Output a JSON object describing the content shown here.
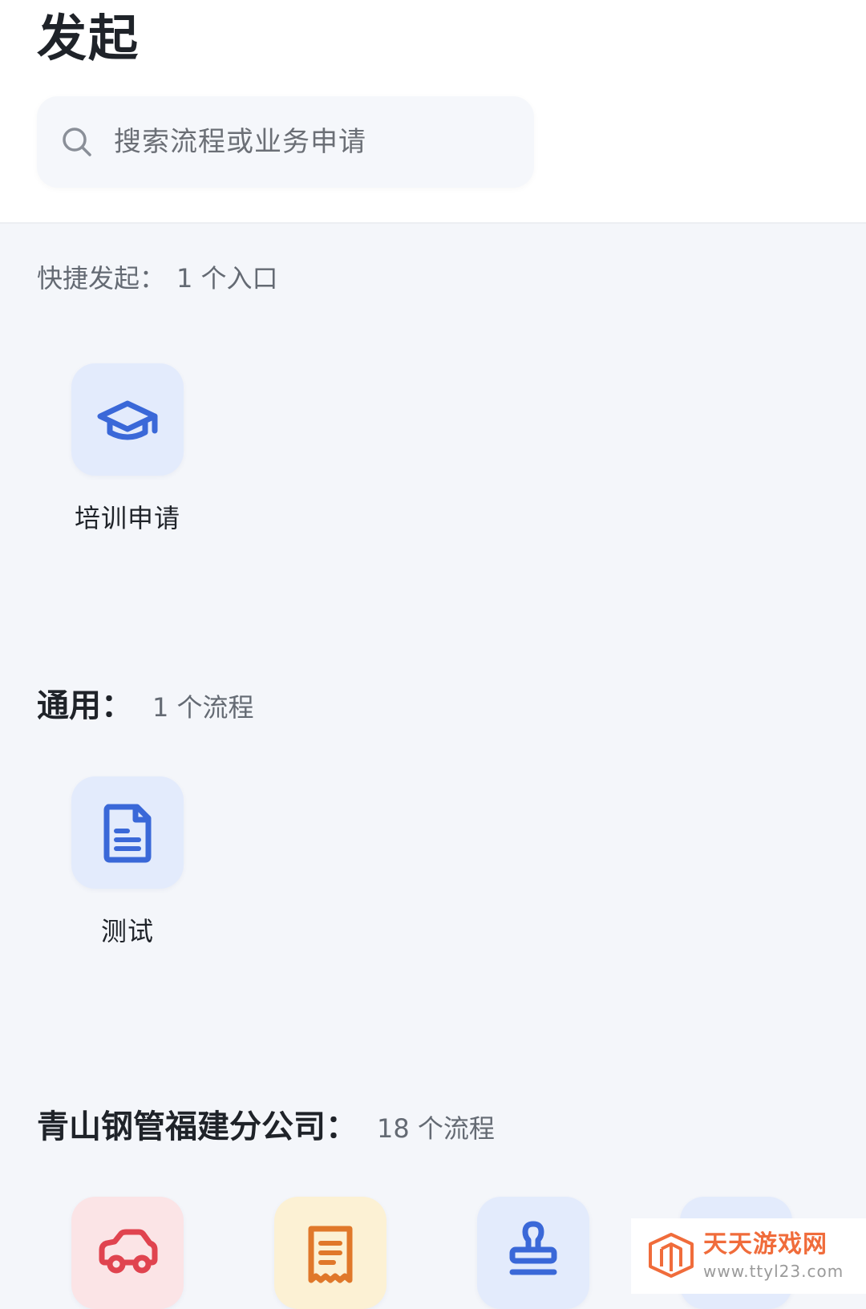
{
  "header": {
    "title": "发起",
    "search": {
      "placeholder": "搜索流程或业务申请"
    }
  },
  "quick": {
    "label": "快捷发起：",
    "count": "1 个入口",
    "items": [
      {
        "label": "培训申请",
        "icon": "graduation-cap-icon"
      }
    ]
  },
  "groups": [
    {
      "name": "通用：",
      "count": "1 个流程",
      "items": [
        {
          "label": "测试",
          "icon": "document-icon"
        }
      ]
    },
    {
      "name": "青山钢管福建分公司：",
      "count": "18 个流程",
      "items": [
        {
          "icon": "car-icon"
        },
        {
          "icon": "receipt-icon"
        },
        {
          "icon": "stamp-icon"
        }
      ]
    }
  ],
  "watermark": {
    "name": "天天游戏网",
    "url": "www.ttyl23.com"
  },
  "colors": {
    "accent": "#3a68d8",
    "tile_blue": "#e3ebfc",
    "tile_red": "#fbe4e6",
    "tile_yellow": "#fcf1d4",
    "icon_red": "#e0434f",
    "icon_orange": "#e0782a",
    "watermark_orange": "#f06c3b"
  }
}
